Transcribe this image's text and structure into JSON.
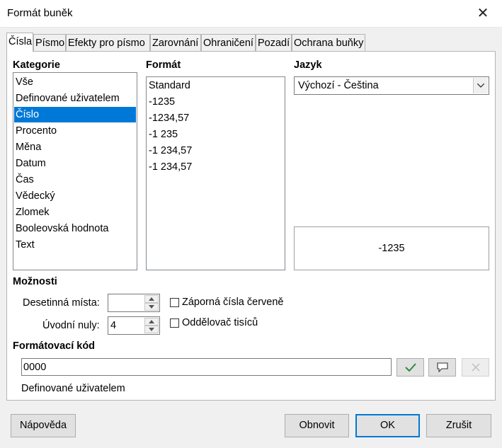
{
  "window": {
    "title": "Formát buněk",
    "close_glyph": "✕"
  },
  "tabs": [
    {
      "label": "Čísla",
      "active": true
    },
    {
      "label": "Písmo"
    },
    {
      "label": "Efekty pro písmo"
    },
    {
      "label": "Zarovnání"
    },
    {
      "label": "Ohraničení"
    },
    {
      "label": "Pozadí"
    },
    {
      "label": "Ochrana buňky"
    }
  ],
  "category": {
    "header": "Kategorie",
    "items": [
      "Vše",
      "Definované uživatelem",
      "Číslo",
      "Procento",
      "Měna",
      "Datum",
      "Čas",
      "Vědecký",
      "Zlomek",
      "Booleovská hodnota",
      "Text"
    ],
    "selected": "Číslo"
  },
  "format": {
    "header": "Formát",
    "items": [
      "Standard",
      "-1235",
      "-1234,57",
      "-1 235",
      "-1 234,57",
      "-1 234,57"
    ]
  },
  "language": {
    "header": "Jazyk",
    "value": "Výchozí - Čeština"
  },
  "preview": {
    "text": "-1235"
  },
  "options": {
    "header": "Možnosti",
    "decimal_label": "Desetinná místa:",
    "decimal_value": "",
    "leading_zeros_label": "Úvodní nuly:",
    "leading_zeros_value": "4",
    "negative_red_label": "Záporná čísla červeně",
    "negative_red_checked": false,
    "thousands_sep_label": "Oddělovač tisíců",
    "thousands_sep_checked": false
  },
  "format_code": {
    "header": "Formátovací kód",
    "value": "0000",
    "description": "Definované uživatelem"
  },
  "buttons": {
    "help": "Nápověda",
    "reset": "Obnovit",
    "ok": "OK",
    "cancel": "Zrušit"
  },
  "icons": {
    "accept": "checkmark-icon",
    "comment": "speech-bubble-icon",
    "delete": "x-icon",
    "accent_color": "#0078d7",
    "check_color": "#2e8b3d"
  }
}
